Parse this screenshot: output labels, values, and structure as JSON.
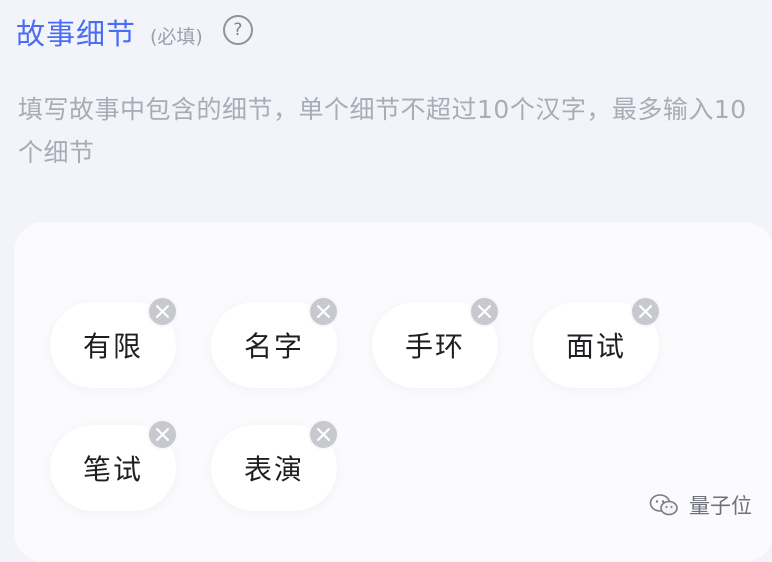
{
  "header": {
    "title": "故事细节",
    "required_label": "(必填)",
    "help_glyph": "?"
  },
  "hint": "填写故事中包含的细节，单个细节不超过10个汉字，最多输入10个细节",
  "tags": [
    {
      "label": "有限"
    },
    {
      "label": "名字"
    },
    {
      "label": "手环"
    },
    {
      "label": "面试"
    },
    {
      "label": "笔试"
    },
    {
      "label": "表演"
    }
  ],
  "watermark": {
    "text": "量子位",
    "icon": "wechat-icon"
  },
  "colors": {
    "accent": "#4a6cf7",
    "hint_text": "#a7adb7",
    "remove_badge": "#c7c9ce"
  }
}
